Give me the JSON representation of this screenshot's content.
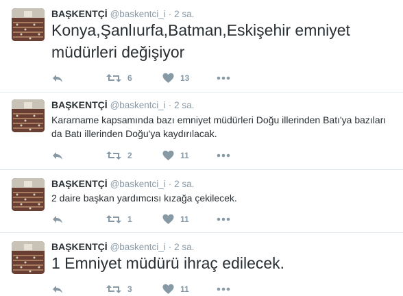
{
  "tweets": [
    {
      "name": "BAŞKENTÇİ",
      "handle": "@baskentci_i",
      "separator": "·",
      "time": "2 sa.",
      "text": "Konya,Şanlıurfa,Batman,Eskişehir emniyet müdürleri değişiyor",
      "size": "big",
      "retweets": "6",
      "likes": "13"
    },
    {
      "name": "BAŞKENTÇİ",
      "handle": "@baskentci_i",
      "separator": "·",
      "time": "2 sa.",
      "text": "Kararname kapsamında bazı emniyet müdürleri Doğu illerinden Batı'ya bazıları da Batı illerinden Doğu'ya kaydırılacak.",
      "size": "small",
      "retweets": "2",
      "likes": "11"
    },
    {
      "name": "BAŞKENTÇİ",
      "handle": "@baskentci_i",
      "separator": "·",
      "time": "2 sa.",
      "text": "2 daire başkan yardımcısı kızağa çekilecek.",
      "size": "small",
      "retweets": "1",
      "likes": "11"
    },
    {
      "name": "BAŞKENTÇİ",
      "handle": "@baskentci_i",
      "separator": "·",
      "time": "2 sa.",
      "text": "1 Emniyet müdürü ihraç edilecek.",
      "size": "big",
      "retweets": "3",
      "likes": "11"
    }
  ],
  "icons": {
    "reply": "reply-icon",
    "retweet": "retweet-icon",
    "like": "heart-icon",
    "more": "more-icon"
  },
  "colors": {
    "text": "#292f33",
    "muted": "#8899a6",
    "divider": "#e1e8ed"
  }
}
